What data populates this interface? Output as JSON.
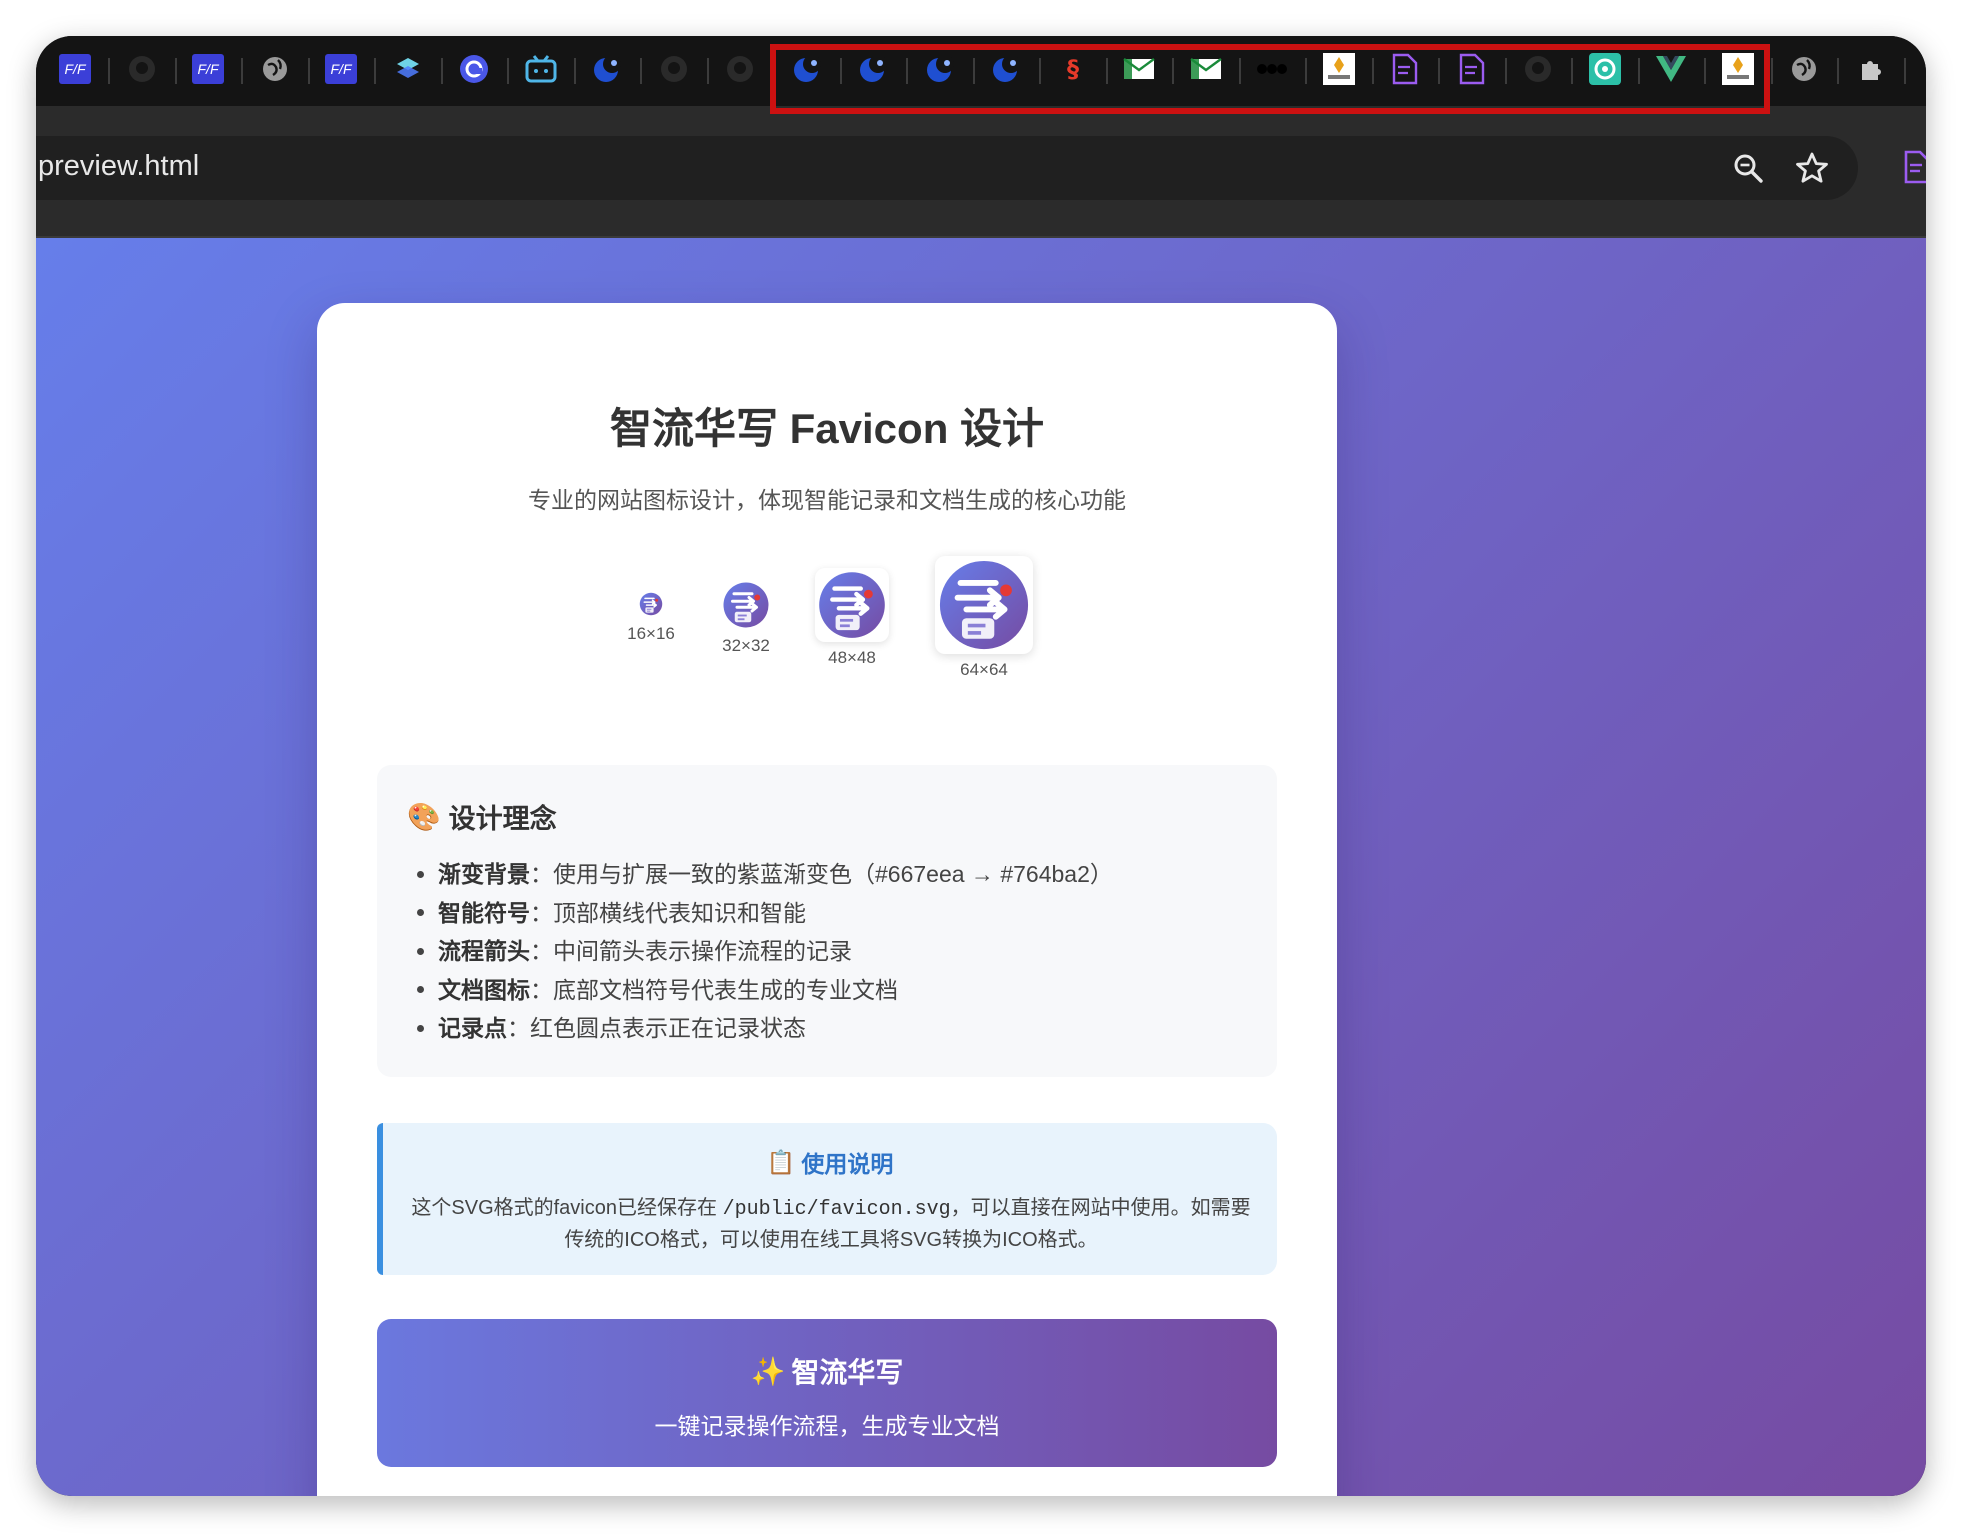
{
  "browser": {
    "url": "preview.html",
    "tabs": [
      {
        "icon": "fz-logo-icon"
      },
      {
        "icon": "github-icon"
      },
      {
        "icon": "fz-logo-icon"
      },
      {
        "icon": "globe-icon"
      },
      {
        "icon": "fz-logo-icon"
      },
      {
        "icon": "layers-icon"
      },
      {
        "icon": "refresh-badge-icon"
      },
      {
        "icon": "bilibili-icon"
      },
      {
        "icon": "blue-moon-icon"
      },
      {
        "icon": "github-icon"
      },
      {
        "icon": "github-icon"
      },
      {
        "icon": "blue-moon-icon"
      },
      {
        "icon": "blue-moon-icon"
      },
      {
        "icon": "blue-moon-icon"
      },
      {
        "icon": "blue-moon-icon"
      },
      {
        "icon": "red-glyph-icon"
      },
      {
        "icon": "mail-icon"
      },
      {
        "icon": "mail-icon"
      },
      {
        "icon": "dots-icon"
      },
      {
        "icon": "brand-tile-icon"
      },
      {
        "icon": "doc-arrow-icon"
      },
      {
        "icon": "doc-arrow-icon"
      },
      {
        "icon": "github-icon"
      },
      {
        "icon": "target-icon"
      },
      {
        "icon": "vue-icon"
      },
      {
        "icon": "brand-tile-icon"
      },
      {
        "icon": "globe-icon"
      },
      {
        "icon": "puzzle-icon"
      }
    ]
  },
  "page": {
    "title": "智流华写 Favicon 设计",
    "subtitle": "专业的网站图标设计，体现智能记录和文档生成的核心功能",
    "previews": [
      {
        "label": "16×16"
      },
      {
        "label": "32×32"
      },
      {
        "label": "48×48"
      },
      {
        "label": "64×64"
      }
    ],
    "concept": {
      "emoji": "🎨",
      "heading": "设计理念",
      "items": [
        {
          "term": "渐变背景",
          "desc": "：使用与扩展一致的紫蓝渐变色（#667eea → #764ba2）"
        },
        {
          "term": "智能符号",
          "desc": "：顶部横线代表知识和智能"
        },
        {
          "term": "流程箭头",
          "desc": "：中间箭头表示操作流程的记录"
        },
        {
          "term": "文档图标",
          "desc": "：底部文档符号代表生成的专业文档"
        },
        {
          "term": "记录点",
          "desc": "：红色圆点表示正在记录状态"
        }
      ]
    },
    "usage": {
      "emoji": "📋",
      "heading": "使用说明",
      "text_before": "这个SVG格式的favicon已经保存在 ",
      "path": "/public/favicon.svg",
      "text_after": "，可以直接在网站中使用。如需要传统的ICO格式，可以使用在线工具将SVG转换为ICO格式。"
    },
    "brand": {
      "emoji": "✨",
      "name": "智流华写",
      "tagline": "一键记录操作流程，生成专业文档"
    }
  },
  "colors": {
    "gradient_start": "#667eea",
    "gradient_end": "#764ba2",
    "record_dot": "#e53935",
    "highlight_box": "#cc1111"
  }
}
